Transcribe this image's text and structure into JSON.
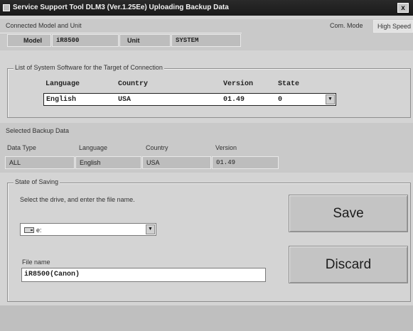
{
  "window": {
    "title": "Service Support Tool DLM3 (Ver.1.25Ee) Uploading Backup Data",
    "close_label": "x"
  },
  "connected": {
    "section_label": "Connected Model and Unit",
    "com_mode_label": "Com. Mode",
    "com_mode_value": "High Speed",
    "model_label": "Model",
    "model_value": "iR8500",
    "unit_label": "Unit",
    "unit_value": "SYSTEM"
  },
  "system_software": {
    "group_label": "List of System Software for the Target of Connection",
    "headers": {
      "language": "Language",
      "country": "Country",
      "version": "Version",
      "state": "State"
    },
    "selected": {
      "language": "English",
      "country": "USA",
      "version": "01.49",
      "state": "0"
    }
  },
  "backup": {
    "section_label": "Selected Backup Data",
    "headers": [
      "Data Type",
      "Language",
      "Country",
      "Version"
    ],
    "values": [
      "ALL",
      "English",
      "USA",
      "01.49"
    ]
  },
  "saving": {
    "group_label": "State of Saving",
    "instruction": "Select the drive, and enter the file name.",
    "drive_value": "e:",
    "file_name_label": "File name",
    "file_name_value": "iR8500(Canon)"
  },
  "buttons": {
    "save": "Save",
    "discard": "Discard"
  },
  "icons": {
    "drive": "drive-icon",
    "dropdown": "chevron-down-icon",
    "app": "app-icon"
  }
}
